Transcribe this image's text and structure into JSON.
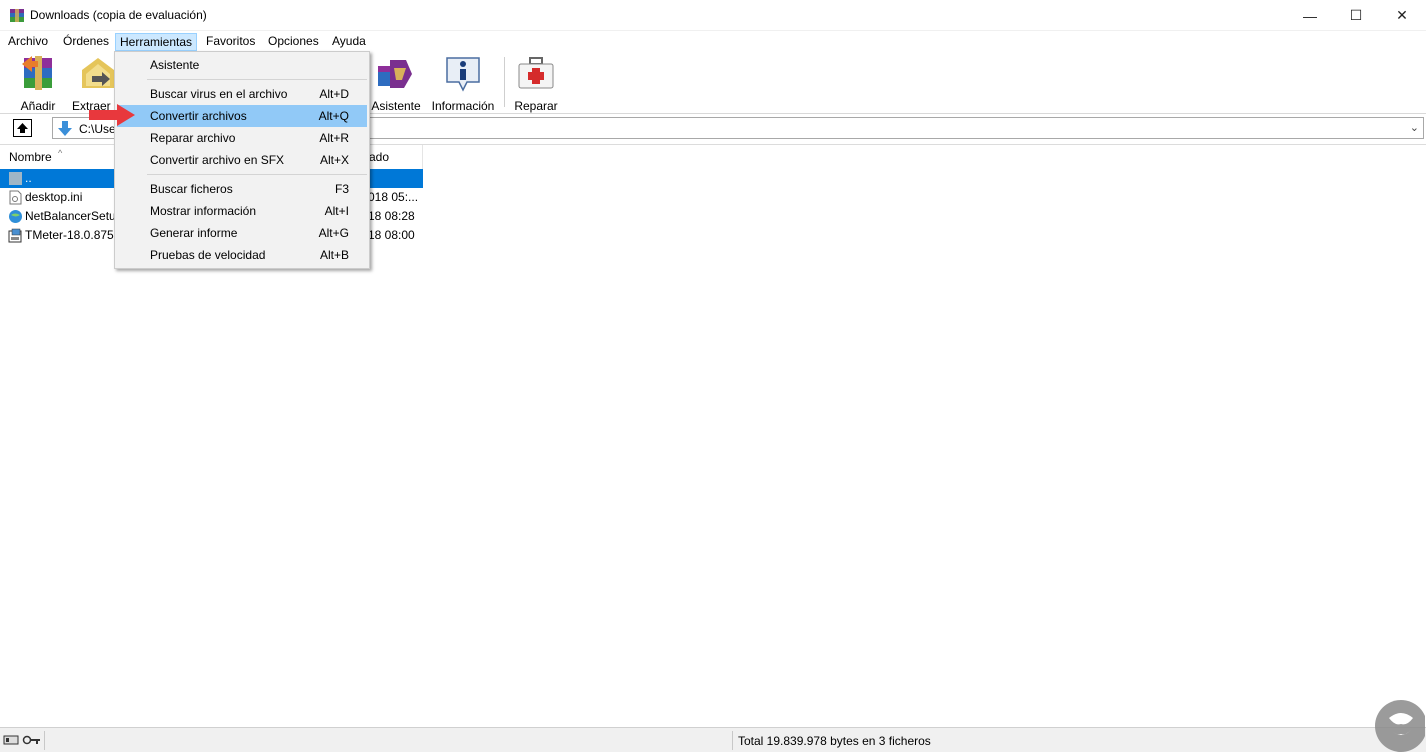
{
  "window": {
    "title": "Downloads (copia de evaluación)",
    "controls": {
      "minimize": "—",
      "maximize": "☐",
      "close": "✕"
    }
  },
  "menubar": [
    {
      "label": "Archivo"
    },
    {
      "label": "Órdenes"
    },
    {
      "label": "Herramientas",
      "active": true
    },
    {
      "label": "Favoritos"
    },
    {
      "label": "Opciones"
    },
    {
      "label": "Ayuda"
    }
  ],
  "toolbar": [
    {
      "label": "Añadir",
      "icon": "add-archive-icon"
    },
    {
      "label": "Extraer e",
      "icon": "extract-icon"
    },
    {
      "label": "Asistente",
      "icon": "wizard-icon"
    },
    {
      "label": "Información",
      "icon": "info-icon"
    },
    {
      "label": "Reparar",
      "icon": "repair-icon"
    }
  ],
  "address": {
    "path": "C:\\Use",
    "icon": "download-arrow-icon"
  },
  "columns": [
    {
      "label": "Nombre"
    },
    {
      "label": "ado"
    }
  ],
  "files": [
    {
      "name": "..",
      "date": "",
      "icon": "folder-up-icon",
      "selected": true
    },
    {
      "name": "desktop.ini",
      "date": "018 05:...",
      "icon": "ini-file-icon",
      "selected": false
    },
    {
      "name": "NetBalancerSetu...",
      "date": "18 08:28",
      "icon": "setup-globe-icon",
      "selected": false
    },
    {
      "name": "TMeter-18.0.875...",
      "date": "18 08:00",
      "icon": "installer-icon",
      "selected": false
    }
  ],
  "tools_menu": {
    "items": [
      {
        "label": "Asistente",
        "shortcut": ""
      },
      {
        "label": "Buscar virus en el archivo",
        "shortcut": "Alt+D"
      },
      {
        "label": "Convertir archivos",
        "shortcut": "Alt+Q",
        "highlighted": true
      },
      {
        "label": "Reparar archivo",
        "shortcut": "Alt+R"
      },
      {
        "label": "Convertir archivo en SFX",
        "shortcut": "Alt+X"
      },
      {
        "label": "Buscar ficheros",
        "shortcut": "F3"
      },
      {
        "label": "Mostrar información",
        "shortcut": "Alt+I"
      },
      {
        "label": "Generar informe",
        "shortcut": "Alt+G"
      },
      {
        "label": "Pruebas de velocidad",
        "shortcut": "Alt+B"
      }
    ]
  },
  "statusbar": {
    "summary": "Total 19.839.978 bytes en 3 ficheros"
  },
  "colors": {
    "selection": "#0078d7",
    "menu_highlight": "#91c9f7",
    "annotation_arrow": "#e8383d"
  }
}
